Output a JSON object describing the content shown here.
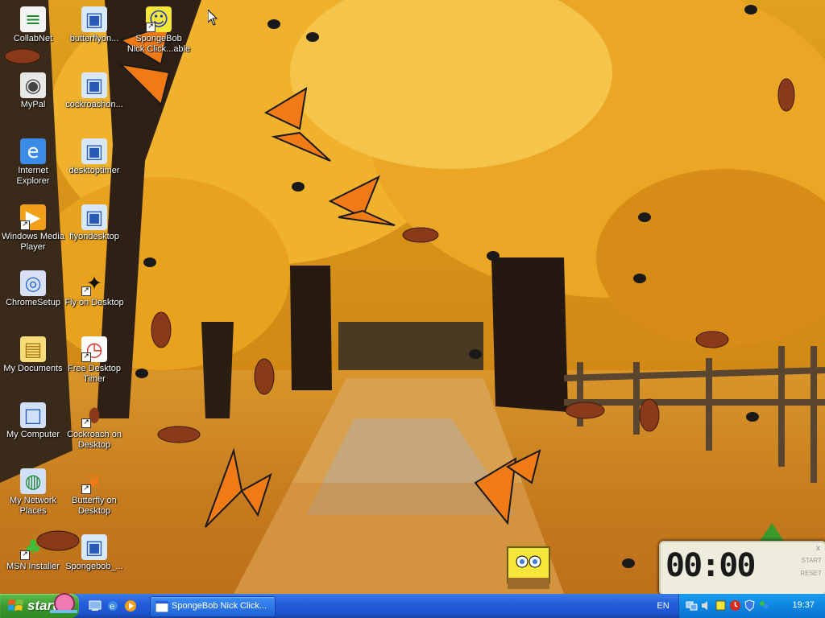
{
  "desktop": {
    "icons": [
      {
        "label": "CollabNet",
        "icon": "collabnet-icon",
        "shortcut": false
      },
      {
        "label": "butterflyon...",
        "icon": "installer-icon",
        "shortcut": false
      },
      {
        "label": "SpongeBob\nNick Click...able",
        "icon": "spongebob-icon",
        "shortcut": true
      },
      {
        "label": "MyPal",
        "icon": "mypal-icon",
        "shortcut": false
      },
      {
        "label": "cockroachon...",
        "icon": "installer-icon",
        "shortcut": false
      },
      {
        "label": "Internet\nExplorer",
        "icon": "internet-explorer-icon",
        "shortcut": false
      },
      {
        "label": "desktoptimer",
        "icon": "installer-icon",
        "shortcut": false
      },
      {
        "label": "Windows Media\nPlayer",
        "icon": "media-player-icon",
        "shortcut": true
      },
      {
        "label": "flyondesktop",
        "icon": "installer-icon",
        "shortcut": false
      },
      {
        "label": "ChromeSetup",
        "icon": "chrome-setup-icon",
        "shortcut": false
      },
      {
        "label": "Fly on Desktop",
        "icon": "fly-icon",
        "shortcut": true
      },
      {
        "label": "My Documents",
        "icon": "folder-icon",
        "shortcut": false
      },
      {
        "label": "Free Desktop\nTimer",
        "icon": "timer-icon",
        "shortcut": true
      },
      {
        "label": "My Computer",
        "icon": "computer-icon",
        "shortcut": false
      },
      {
        "label": "Cockroach on\nDesktop",
        "icon": "cockroach-icon",
        "shortcut": true
      },
      {
        "label": "My Network\nPlaces",
        "icon": "network-icon",
        "shortcut": false
      },
      {
        "label": "Butterfly on\nDesktop",
        "icon": "butterfly-icon",
        "shortcut": true
      },
      {
        "label": "MSN Installer",
        "icon": "msn-icon",
        "shortcut": true
      },
      {
        "label": "Spongebob_...",
        "icon": "installer-icon",
        "shortcut": false
      }
    ]
  },
  "taskbar": {
    "start_label": "start",
    "quick_launch": [
      "show-desktop-icon",
      "internet-explorer-icon",
      "media-player-icon"
    ],
    "task_button_label": "SpongeBob Nick Click...",
    "language": "EN",
    "clock": "19:37",
    "tray_icons": [
      "network-icon",
      "speaker-icon",
      "spongebob-tray-icon",
      "timer-tray-icon",
      "security-icon",
      "messenger-icon"
    ]
  },
  "timer_widget": {
    "display": "00:00",
    "start_label": "START",
    "reset_label": "RESET",
    "close_label": "x"
  },
  "colors": {
    "taskbar_blue": "#245edb",
    "start_green": "#3c9a2f",
    "tray_blue": "#0e86e0"
  }
}
